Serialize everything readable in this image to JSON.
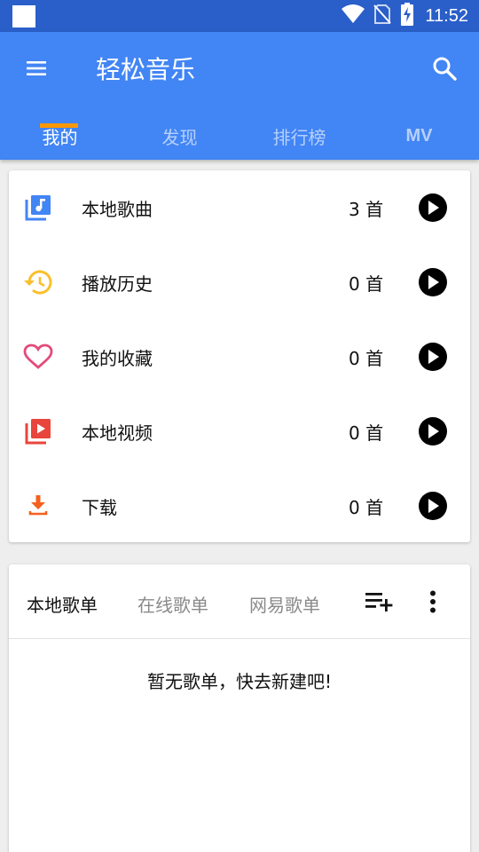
{
  "status_bar": {
    "time": "11:52",
    "icons": [
      "notification-square-icon",
      "wifi-icon",
      "no-sim-icon",
      "battery-charging-icon"
    ]
  },
  "app_bar": {
    "title": "轻松音乐",
    "menu_icon": "menu-icon",
    "search_icon": "search-icon",
    "color": "#4285f4"
  },
  "tabs": [
    {
      "label": "我的",
      "active": true
    },
    {
      "label": "发现",
      "active": false
    },
    {
      "label": "排行榜",
      "active": false
    },
    {
      "label": "MV",
      "active": false
    }
  ],
  "tab_indicator_color": "#ff9800",
  "library": {
    "items": [
      {
        "label": "本地歌曲",
        "count": "3 首",
        "icon": "music-library-icon",
        "icon_color": "#4285f4"
      },
      {
        "label": "播放历史",
        "count": "0 首",
        "icon": "history-icon",
        "icon_color": "#f9c02c"
      },
      {
        "label": "我的收藏",
        "count": "0 首",
        "icon": "heart-icon",
        "icon_color": "#e44a7a"
      },
      {
        "label": "本地视频",
        "count": "0 首",
        "icon": "video-library-icon",
        "icon_color": "#e8453c"
      },
      {
        "label": "下载",
        "count": "0 首",
        "icon": "download-icon",
        "icon_color": "#f4611e"
      }
    ]
  },
  "playlists": {
    "tabs": [
      {
        "label": "本地歌单",
        "active": true
      },
      {
        "label": "在线歌单",
        "active": false
      },
      {
        "label": "网易歌单",
        "active": false
      }
    ],
    "add_icon": "playlist-add-icon",
    "more_icon": "more-vert-icon",
    "empty_text": "暂无歌单，快去新建吧!"
  }
}
